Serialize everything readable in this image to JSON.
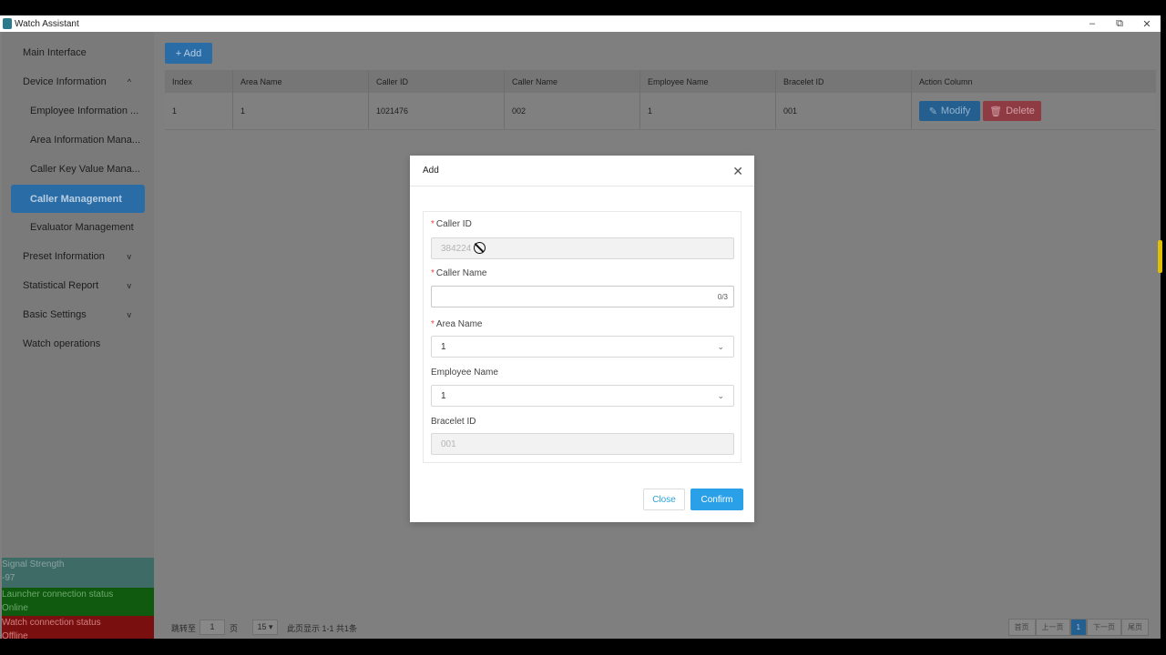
{
  "window": {
    "title": "Watch Assistant",
    "controls": [
      "–",
      "⧉",
      "✕"
    ]
  },
  "sidebar": {
    "items": [
      {
        "label": "Main Interface",
        "chevron": ""
      },
      {
        "label": "Device Information",
        "chevron": "^"
      },
      {
        "label": "Employee Information ...",
        "chevron": ""
      },
      {
        "label": "Area Information Mana...",
        "chevron": ""
      },
      {
        "label": "Caller Key Value Mana...",
        "chevron": ""
      },
      {
        "label": "Caller Management",
        "chevron": "",
        "active": true
      },
      {
        "label": "Evaluator Management",
        "chevron": ""
      },
      {
        "label": "Preset Information",
        "chevron": "v"
      },
      {
        "label": "Statistical Report",
        "chevron": "v"
      },
      {
        "label": "Basic Settings",
        "chevron": "v"
      },
      {
        "label": "Watch operations",
        "chevron": ""
      }
    ],
    "status": {
      "signal_label": "Signal Strength",
      "signal_value": "-97",
      "launcher_label": "Launcher connection status",
      "launcher_value": "Online",
      "watch_label": "Watch connection status",
      "watch_value": "Offline"
    }
  },
  "toolbar": {
    "add_label": "+ Add"
  },
  "table": {
    "columns": [
      "Index",
      "Area Name",
      "Caller ID",
      "Caller Name",
      "Employee Name",
      "Bracelet ID",
      "Action Column"
    ],
    "rows": [
      {
        "index": "1",
        "area_name": "1",
        "caller_id": "1021476",
        "caller_name": "002",
        "employee_name": "1",
        "bracelet_id": "001"
      }
    ],
    "modify_label": "Modify",
    "delete_label": "Delete"
  },
  "pager": {
    "goto_label": "跳转至",
    "page_value": "1",
    "page_unit": "页",
    "page_size": "15 ▾",
    "summary": "此页显示 1-1 共1条",
    "buttons": [
      "首页",
      "上一页",
      "1",
      "下一页",
      "尾页"
    ]
  },
  "modal": {
    "title": "Add",
    "fields": {
      "caller_id_label": "Caller ID",
      "caller_id_value": "384224",
      "caller_name_label": "Caller Name",
      "caller_name_value": "",
      "caller_name_counter": "0/3",
      "area_name_label": "Area Name",
      "area_name_value": "1",
      "employee_name_label": "Employee Name",
      "employee_name_value": "1",
      "bracelet_id_label": "Bracelet ID",
      "bracelet_id_value": "001"
    },
    "close_label": "Close",
    "confirm_label": "Confirm"
  },
  "colors": {
    "accent": "#2aa0e8",
    "required_star": "#ee4444"
  }
}
